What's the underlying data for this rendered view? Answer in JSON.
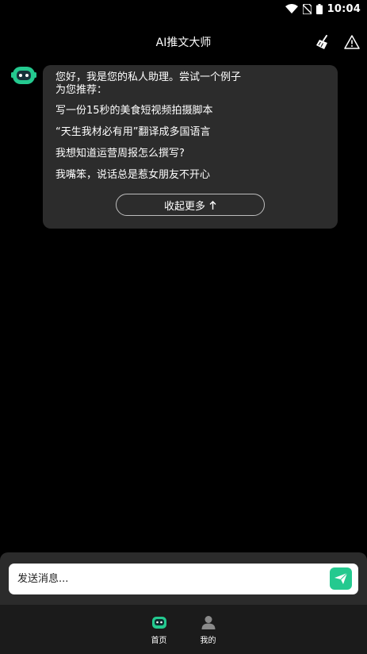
{
  "status_bar": {
    "time": "10:04"
  },
  "header": {
    "title": "AI推文大师"
  },
  "chat": {
    "greeting_line1": "您好，我是您的私人助理。尝试一个例子",
    "greeting_line2": "为您推荐：",
    "suggestions": [
      "写一份15秒的美食短视频拍摄脚本",
      "“天生我材必有用”翻译成多国语言",
      "我想知道运营周报怎么撰写?",
      "我嘴笨，说话总是惹女朋友不开心"
    ],
    "collapse_label": "收起更多"
  },
  "composer": {
    "placeholder": "发送消息..."
  },
  "tabs": [
    {
      "label": "首页",
      "icon": "robot-icon"
    },
    {
      "label": "我的",
      "icon": "user-icon"
    }
  ],
  "colors": {
    "accent": "#24c98f",
    "bubble": "#2c2c2c",
    "panel": "#2b2b2b",
    "tabbar": "#1b1b1b"
  }
}
